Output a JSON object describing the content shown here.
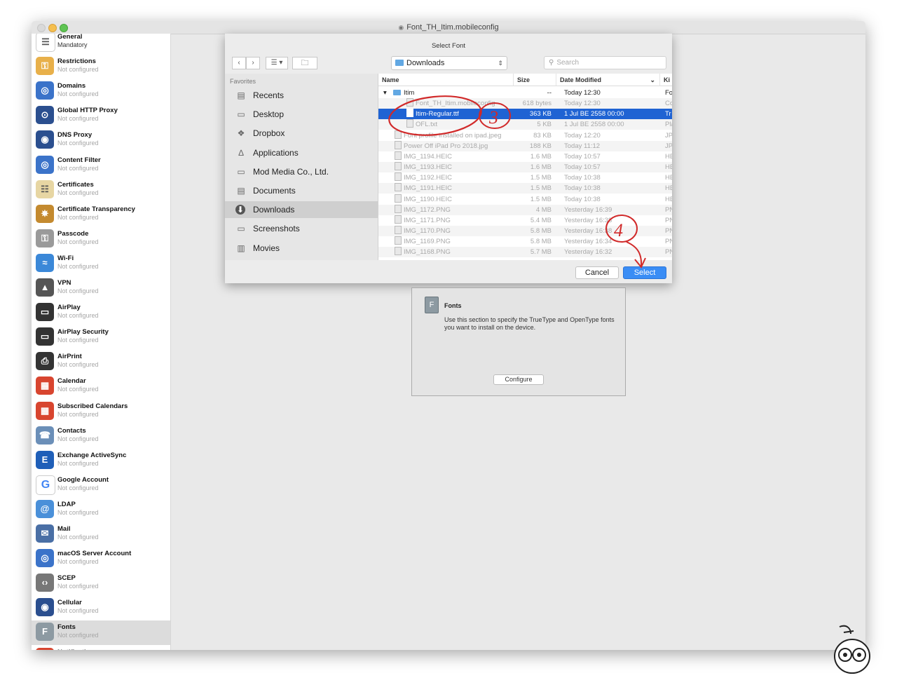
{
  "window": {
    "title": "Font_TH_Itim.mobileconfig"
  },
  "sidebar": {
    "items": [
      {
        "title": "General",
        "subtitle": "Mandatory",
        "icon": "general-icon",
        "color": "#ffffff"
      },
      {
        "title": "Restrictions",
        "subtitle": "Not configured",
        "icon": "restrictions-icon",
        "color": "#e8b04a"
      },
      {
        "title": "Domains",
        "subtitle": "Not configured",
        "icon": "globe-icon",
        "color": "#3b73c9"
      },
      {
        "title": "Global HTTP Proxy",
        "subtitle": "Not configured",
        "icon": "proxy-icon",
        "color": "#2b4f8f"
      },
      {
        "title": "DNS Proxy",
        "subtitle": "Not configured",
        "icon": "dns-icon",
        "color": "#2b4f8f"
      },
      {
        "title": "Content Filter",
        "subtitle": "Not configured",
        "icon": "content-filter-icon",
        "color": "#3b73c9"
      },
      {
        "title": "Certificates",
        "subtitle": "Not configured",
        "icon": "certificate-icon",
        "color": "#e7d6a3"
      },
      {
        "title": "Certificate Transparency",
        "subtitle": "Not configured",
        "icon": "transparency-icon",
        "color": "#c48a2f"
      },
      {
        "title": "Passcode",
        "subtitle": "Not configured",
        "icon": "key-icon",
        "color": "#9a9a9a"
      },
      {
        "title": "Wi-Fi",
        "subtitle": "Not configured",
        "icon": "wifi-icon",
        "color": "#3b88d8"
      },
      {
        "title": "VPN",
        "subtitle": "Not configured",
        "icon": "vpn-icon",
        "color": "#555555"
      },
      {
        "title": "AirPlay",
        "subtitle": "Not configured",
        "icon": "airplay-icon",
        "color": "#333333"
      },
      {
        "title": "AirPlay Security",
        "subtitle": "Not configured",
        "icon": "airplay-security-icon",
        "color": "#333333"
      },
      {
        "title": "AirPrint",
        "subtitle": "Not configured",
        "icon": "printer-icon",
        "color": "#333333"
      },
      {
        "title": "Calendar",
        "subtitle": "Not configured",
        "icon": "calendar-icon",
        "color": "#d8452f"
      },
      {
        "title": "Subscribed Calendars",
        "subtitle": "Not configured",
        "icon": "subscribed-calendar-icon",
        "color": "#d8452f"
      },
      {
        "title": "Contacts",
        "subtitle": "Not configured",
        "icon": "contacts-icon",
        "color": "#6b8fb8"
      },
      {
        "title": "Exchange ActiveSync",
        "subtitle": "Not configured",
        "icon": "exchange-icon",
        "color": "#1f5fb8"
      },
      {
        "title": "Google Account",
        "subtitle": "Not configured",
        "icon": "google-icon",
        "color": "#ffffff"
      },
      {
        "title": "LDAP",
        "subtitle": "Not configured",
        "icon": "ldap-icon",
        "color": "#4a90d9"
      },
      {
        "title": "Mail",
        "subtitle": "Not configured",
        "icon": "mail-icon",
        "color": "#4a6fa5"
      },
      {
        "title": "macOS Server Account",
        "subtitle": "Not configured",
        "icon": "server-icon",
        "color": "#3b73c9"
      },
      {
        "title": "SCEP",
        "subtitle": "Not configured",
        "icon": "scep-icon",
        "color": "#777777"
      },
      {
        "title": "Cellular",
        "subtitle": "Not configured",
        "icon": "cellular-icon",
        "color": "#2b4f8f"
      },
      {
        "title": "Fonts",
        "subtitle": "Not configured",
        "icon": "fonts-icon",
        "color": "#8d9aa2"
      },
      {
        "title": "Notifications",
        "subtitle": "",
        "icon": "notifications-icon",
        "color": "#d8452f"
      }
    ],
    "selected_index": 24
  },
  "dialog": {
    "title": "Select Font",
    "location": "Downloads",
    "search_placeholder": "Search",
    "favorites_header": "Favorites",
    "favorites": [
      {
        "label": "Recents",
        "icon": "recents-icon"
      },
      {
        "label": "Desktop",
        "icon": "desktop-icon"
      },
      {
        "label": "Dropbox",
        "icon": "dropbox-icon"
      },
      {
        "label": "Applications",
        "icon": "applications-icon"
      },
      {
        "label": "Mod Media Co., Ltd.",
        "icon": "folder-icon"
      },
      {
        "label": "Documents",
        "icon": "documents-icon"
      },
      {
        "label": "Downloads",
        "icon": "downloads-icon"
      },
      {
        "label": "Screenshots",
        "icon": "folder-icon"
      },
      {
        "label": "Movies",
        "icon": "movies-icon"
      }
    ],
    "favorites_selected": 6,
    "columns": {
      "name": "Name",
      "size": "Size",
      "date": "Date Modified",
      "kind": "Ki"
    },
    "files": [
      {
        "name": "Itim",
        "size": "--",
        "date": "Today 12:30",
        "kind": "Fo",
        "folder": true,
        "indent": 0,
        "dim": false
      },
      {
        "name": "Font_TH_Itim.mobileconfig",
        "size": "618 bytes",
        "date": "Today 12:30",
        "kind": "Co",
        "indent": 1,
        "dim": true
      },
      {
        "name": "Itim-Regular.ttf",
        "size": "363 KB",
        "date": "1 Jul BE 2558 00:00",
        "kind": "Tr",
        "indent": 1,
        "dim": false,
        "selected": true
      },
      {
        "name": "OFL.txt",
        "size": "5 KB",
        "date": "1 Jul BE 2558 00:00",
        "kind": "Pla",
        "indent": 1,
        "dim": true
      },
      {
        "name": "Font profile installed on ipad.jpeg",
        "size": "83 KB",
        "date": "Today 12:20",
        "kind": "JP",
        "indent": 0,
        "dim": true
      },
      {
        "name": "Power Off iPad Pro 2018.jpg",
        "size": "188 KB",
        "date": "Today 11:12",
        "kind": "JP",
        "indent": 0,
        "dim": true
      },
      {
        "name": "IMG_1194.HEIC",
        "size": "1.6 MB",
        "date": "Today 10:57",
        "kind": "HE",
        "indent": 0,
        "dim": true
      },
      {
        "name": "IMG_1193.HEIC",
        "size": "1.6 MB",
        "date": "Today 10:57",
        "kind": "HE",
        "indent": 0,
        "dim": true
      },
      {
        "name": "IMG_1192.HEIC",
        "size": "1.5 MB",
        "date": "Today 10:38",
        "kind": "HE",
        "indent": 0,
        "dim": true
      },
      {
        "name": "IMG_1191.HEIC",
        "size": "1.5 MB",
        "date": "Today 10:38",
        "kind": "HE",
        "indent": 0,
        "dim": true
      },
      {
        "name": "IMG_1190.HEIC",
        "size": "1.5 MB",
        "date": "Today 10:38",
        "kind": "HE",
        "indent": 0,
        "dim": true
      },
      {
        "name": "IMG_1172.PNG",
        "size": "4 MB",
        "date": "Yesterday 16:39",
        "kind": "PN",
        "indent": 0,
        "dim": true
      },
      {
        "name": "IMG_1171.PNG",
        "size": "5.4 MB",
        "date": "Yesterday 16:38",
        "kind": "PN",
        "indent": 0,
        "dim": true
      },
      {
        "name": "IMG_1170.PNG",
        "size": "5.8 MB",
        "date": "Yesterday 16:38",
        "kind": "PN",
        "indent": 0,
        "dim": true
      },
      {
        "name": "IMG_1169.PNG",
        "size": "5.8 MB",
        "date": "Yesterday 16:34",
        "kind": "PN",
        "indent": 0,
        "dim": true
      },
      {
        "name": "IMG_1168.PNG",
        "size": "5.7 MB",
        "date": "Yesterday 16:32",
        "kind": "PN",
        "indent": 0,
        "dim": true
      }
    ],
    "cancel_label": "Cancel",
    "select_label": "Select"
  },
  "fonts_panel": {
    "title": "Fonts",
    "description": "Use this section to specify the TrueType and OpenType fonts you want to install on the device.",
    "configure_label": "Configure"
  },
  "annotations": {
    "step3": "3",
    "step4": "4",
    "color": "#d12a2a"
  }
}
